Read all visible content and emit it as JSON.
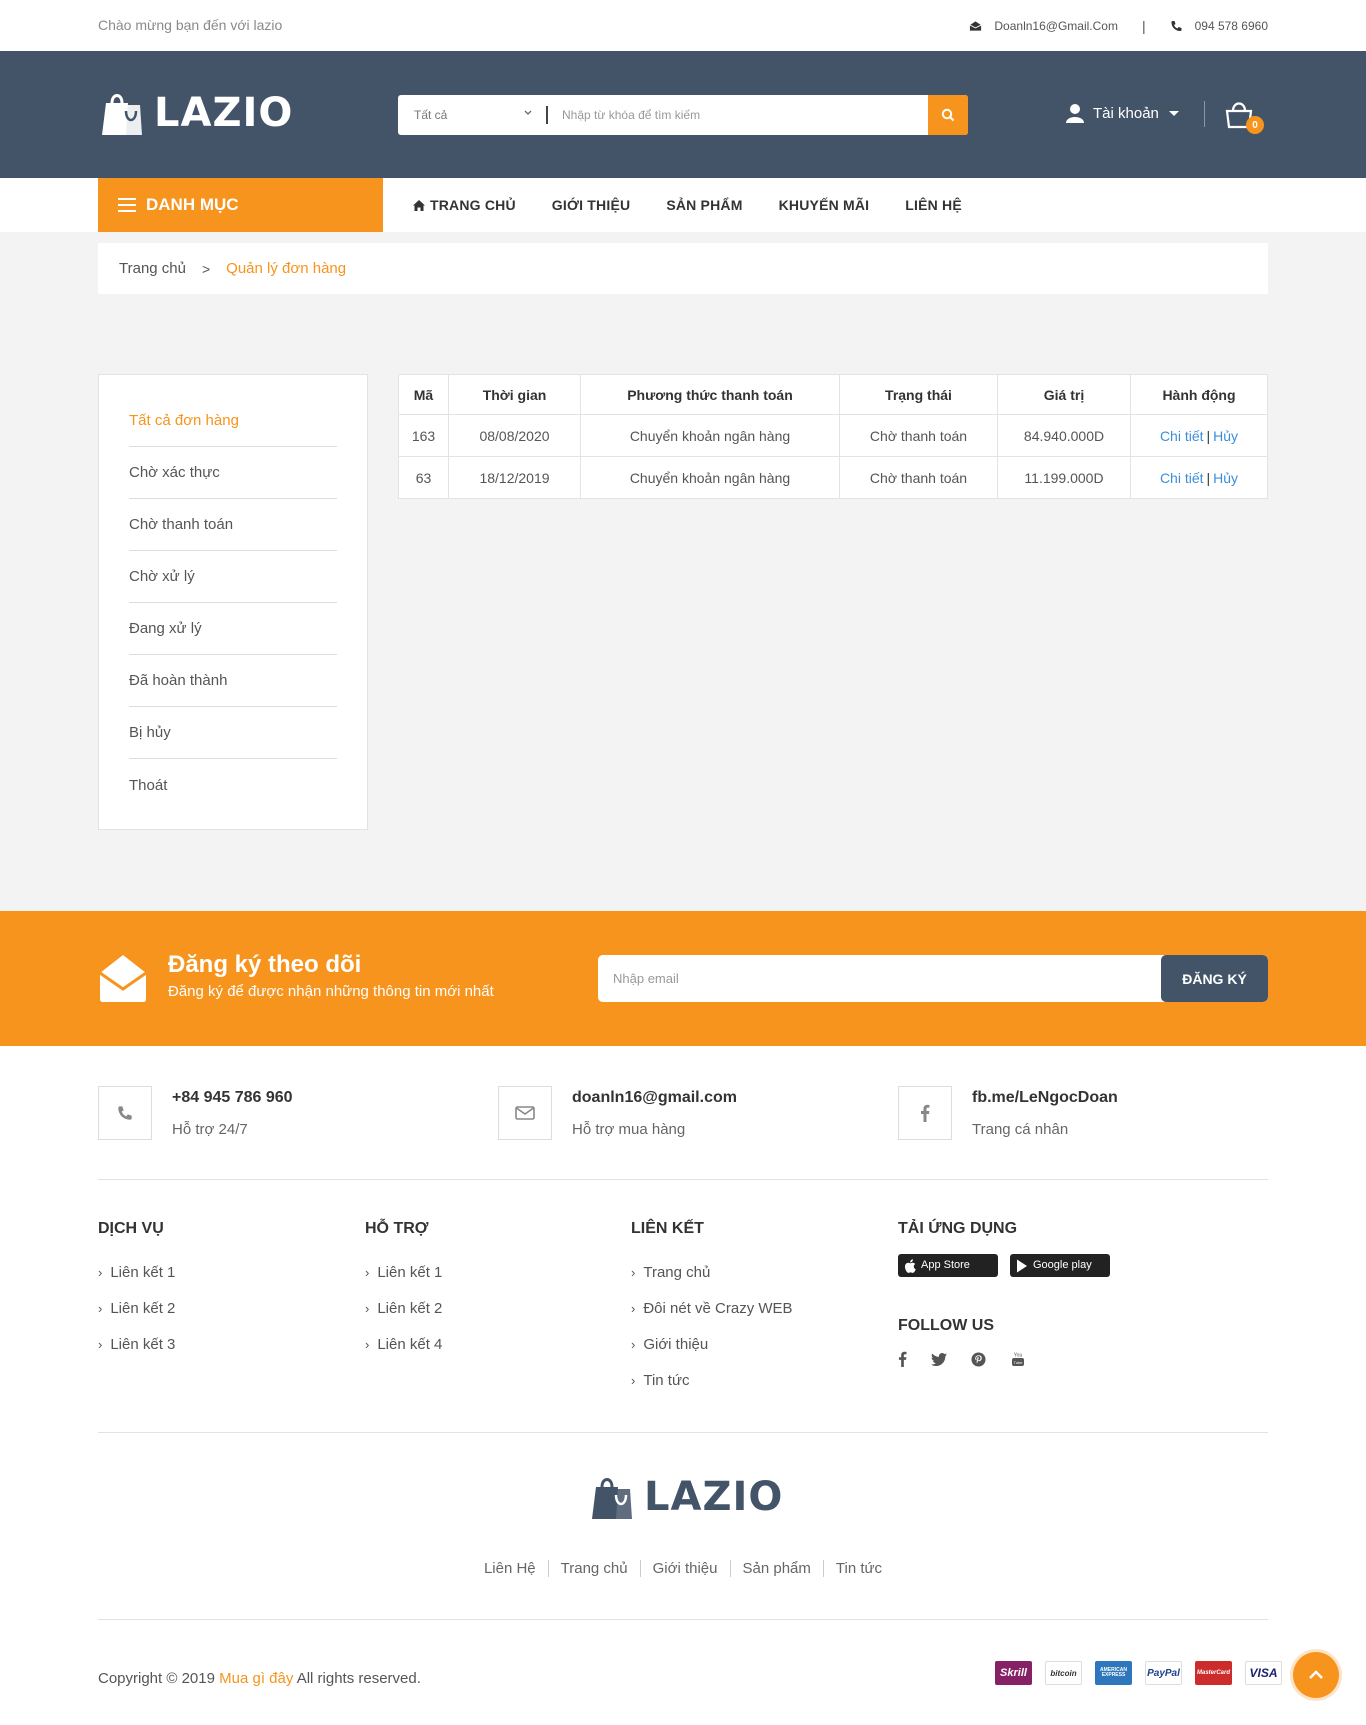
{
  "topbar": {
    "welcome": "Chào mừng bạn đến với lazio",
    "email": "Doanln16@Gmail.Com",
    "phone": "094 578 6960"
  },
  "header": {
    "logo_text": "LAZIO",
    "search_category": "Tất cả",
    "search_placeholder": "Nhập từ khóa để tìm kiếm",
    "account_label": "Tài khoản",
    "cart_count": "0"
  },
  "nav": {
    "menu_label": "DANH MỤC",
    "items": [
      "TRANG CHỦ",
      "GIỚI THIỆU",
      "SẢN PHẨM",
      "KHUYẾN MÃI",
      "LIÊN HỆ"
    ]
  },
  "breadcrumb": {
    "home": "Trang chủ",
    "separator": ">",
    "current": "Quản lý đơn hàng"
  },
  "sidebar": {
    "items": [
      "Tất cả đơn hàng",
      "Chờ xác thực",
      "Chờ thanh toán",
      "Chờ xử lý",
      "Đang xử lý",
      "Đã hoàn thành",
      "Bị hủy",
      "Thoát"
    ]
  },
  "orders": {
    "headers": [
      "Mã",
      "Thời gian",
      "Phương thức thanh toán",
      "Trạng thái",
      "Giá trị",
      "Hành động"
    ],
    "rows": [
      {
        "id": "163",
        "time": "08/08/2020",
        "method": "Chuyển khoản ngân hàng",
        "status": "Chờ thanh toán",
        "value": "84.940.000D",
        "detail": "Chi tiết",
        "sep": "|",
        "cancel": "Hủy"
      },
      {
        "id": "63",
        "time": "18/12/2019",
        "method": "Chuyển khoản ngân hàng",
        "status": "Chờ thanh toán",
        "value": "11.199.000D",
        "detail": "Chi tiết",
        "sep": "|",
        "cancel": "Hủy"
      }
    ]
  },
  "subscribe": {
    "title": "Đăng ký theo dõi",
    "subtitle": "Đăng ký để được nhận những thông tin mới nhất",
    "placeholder": "Nhập email",
    "button": "ĐĂNG KÝ"
  },
  "contacts": [
    {
      "main": "+84 945 786 960",
      "sub": "Hỗ trợ 24/7",
      "icon": "phone-icon"
    },
    {
      "main": "doanln16@gmail.com",
      "sub": "Hỗ trợ mua hàng",
      "icon": "envelope-icon"
    },
    {
      "main": "fb.me/LeNgocDoan",
      "sub": "Trang cá nhân",
      "icon": "facebook-icon"
    }
  ],
  "footer_cols": {
    "service": {
      "title": "DỊCH VỤ",
      "links": [
        "Liên kết 1",
        "Liên kết 2",
        "Liên kết 3"
      ]
    },
    "support": {
      "title": "HỖ TRỢ",
      "links": [
        "Liên kết 1",
        "Liên kết 2",
        "Liên kết 4"
      ]
    },
    "links": {
      "title": "LIÊN KẾT",
      "links": [
        "Trang chủ",
        "Đôi nét về Crazy WEB",
        "Giới thiệu",
        "Tin tức"
      ]
    },
    "apps": {
      "title": "TẢI ỨNG DỤNG",
      "appstore": "App Store",
      "googleplay": "Google play",
      "follow": "FOLLOW US"
    }
  },
  "footer_logo": "LAZIO",
  "footer_links": [
    "Liên Hệ",
    "Trang chủ",
    "Giới thiệu",
    "Sản phẩm",
    "Tin tức"
  ],
  "copyright": {
    "prefix": "Copyright © 2019",
    "brand": "Mua gì đây",
    "suffix": "All rights reserved."
  },
  "payments": [
    "Skrill",
    "bitcoin",
    "AMERICAN EXPRESS",
    "PayPal",
    "MasterCard",
    "VISA"
  ],
  "colors": {
    "accent": "#f7941d",
    "header": "#435469",
    "link": "#3b8fd8"
  }
}
